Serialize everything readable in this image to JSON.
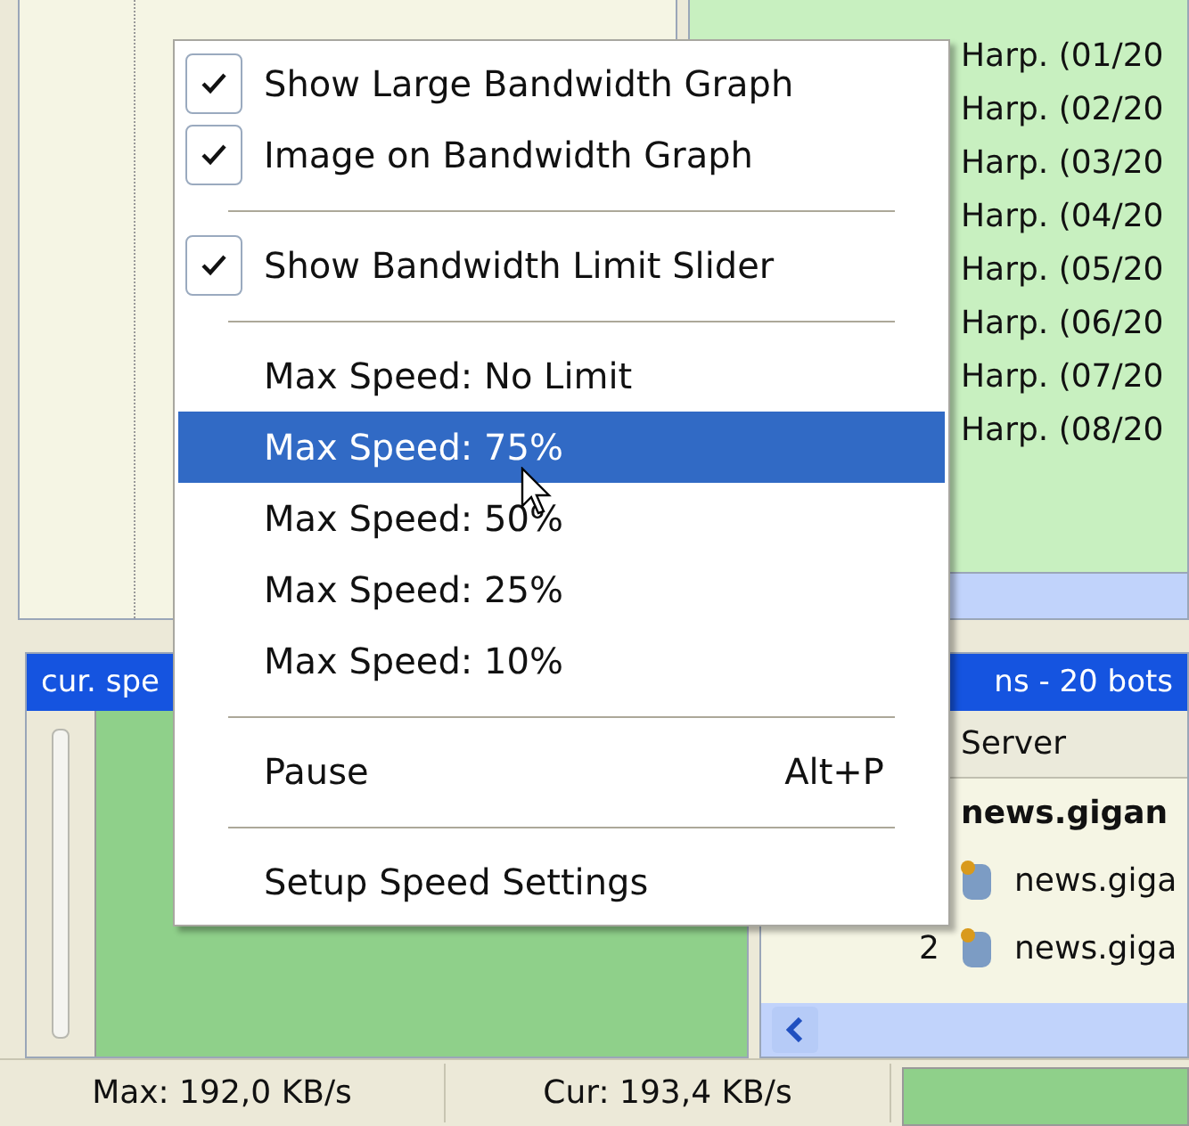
{
  "file_list": {
    "rows": [
      {
        "name": "Harp. (01/20"
      },
      {
        "name": "Harp. (02/20"
      },
      {
        "name": "Harp. (03/20"
      },
      {
        "name": "Harp. (04/20"
      },
      {
        "name": "Harp. (05/20"
      },
      {
        "name": "Harp. (06/20"
      },
      {
        "name": "Harp. (07/20"
      },
      {
        "name": "Harp. (08/20"
      }
    ]
  },
  "speed_panel": {
    "title": "cur. spe"
  },
  "connections_panel": {
    "title": "ns  -  20 bots",
    "columns": [
      "Server"
    ],
    "rows": [
      {
        "number": "",
        "name": "news.gigan",
        "kind": "group"
      },
      {
        "number": "",
        "name": "news.giga",
        "kind": "server"
      },
      {
        "number": "2",
        "name": "news.giga",
        "kind": "server"
      }
    ]
  },
  "status_bar": {
    "max": "Max: 192,0 KB/s",
    "cur": "Cur: 193,4 KB/s"
  },
  "context_menu": {
    "items": [
      {
        "kind": "check",
        "label": "Show Large Bandwidth Graph",
        "checked": true,
        "selected": false
      },
      {
        "kind": "check",
        "label": "Image on Bandwidth Graph",
        "checked": true,
        "selected": false
      },
      {
        "kind": "separator"
      },
      {
        "kind": "check",
        "label": "Show Bandwidth Limit Slider",
        "checked": true,
        "selected": false
      },
      {
        "kind": "separator"
      },
      {
        "kind": "action",
        "label": "Max Speed: No Limit",
        "selected": false
      },
      {
        "kind": "action",
        "label": "Max Speed: 75%",
        "selected": true
      },
      {
        "kind": "action",
        "label": "Max Speed: 50%",
        "selected": false
      },
      {
        "kind": "action",
        "label": "Max Speed: 25%",
        "selected": false
      },
      {
        "kind": "action",
        "label": "Max Speed: 10%",
        "selected": false
      },
      {
        "kind": "separator"
      },
      {
        "kind": "action",
        "label": "Pause",
        "shortcut": "Alt+P",
        "selected": false
      },
      {
        "kind": "separator"
      },
      {
        "kind": "action",
        "label": "Setup Speed Settings",
        "selected": false
      }
    ]
  }
}
